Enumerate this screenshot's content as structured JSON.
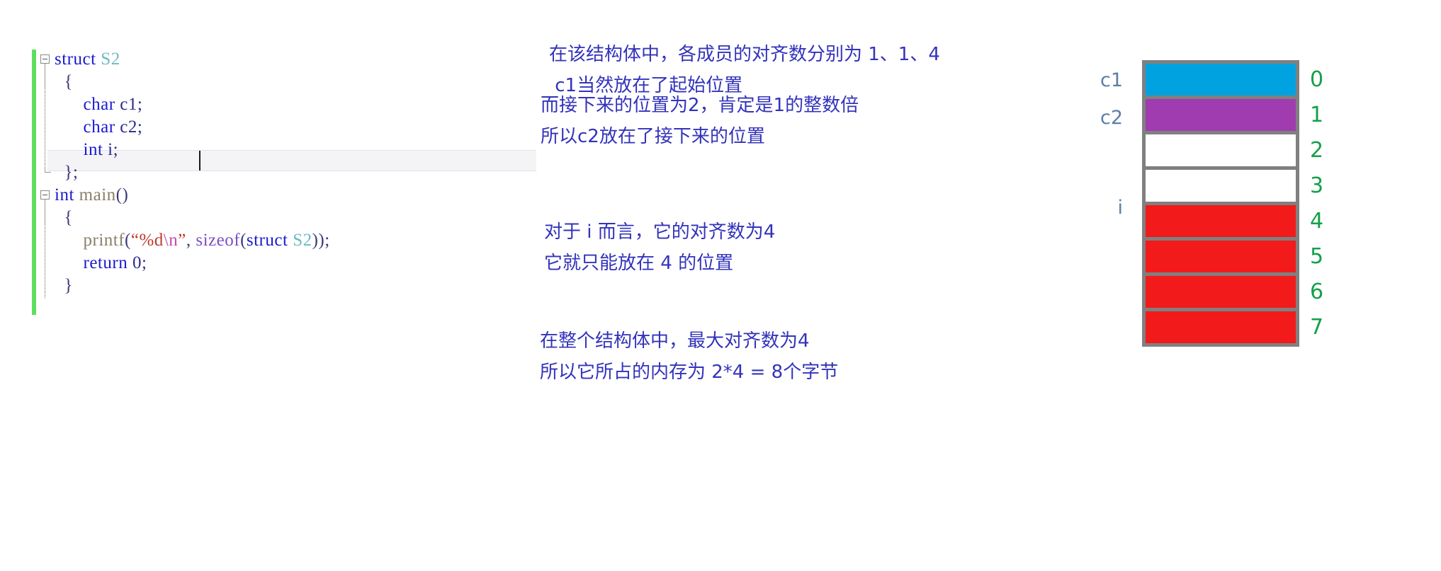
{
  "editor": {
    "language": "c",
    "change_bar_color": "#5fdf5f",
    "current_line_index": 3,
    "lines": [
      {
        "fold": "minus",
        "tokens": [
          {
            "t": "struct",
            "c": "kw"
          },
          {
            "t": " ",
            "c": "plain"
          },
          {
            "t": "S2",
            "c": "type"
          }
        ]
      },
      {
        "fold": "none",
        "tokens": [
          {
            "t": "  {",
            "c": "punc"
          }
        ]
      },
      {
        "fold": "none",
        "tokens": [
          {
            "t": "      ",
            "c": "plain"
          },
          {
            "t": "char",
            "c": "kw"
          },
          {
            "t": " c1;",
            "c": "plain"
          }
        ]
      },
      {
        "fold": "none",
        "tokens": [
          {
            "t": "      ",
            "c": "plain"
          },
          {
            "t": "char",
            "c": "kw"
          },
          {
            "t": " c2;",
            "c": "plain"
          }
        ]
      },
      {
        "fold": "none",
        "tokens": [
          {
            "t": "      ",
            "c": "plain"
          },
          {
            "t": "int",
            "c": "kw"
          },
          {
            "t": " i;",
            "c": "plain"
          }
        ]
      },
      {
        "fold": "none",
        "tokens": [
          {
            "t": "  };",
            "c": "punc"
          }
        ]
      },
      {
        "fold": "minus",
        "tokens": [
          {
            "t": "int",
            "c": "kw"
          },
          {
            "t": " ",
            "c": "plain"
          },
          {
            "t": "main",
            "c": "fn"
          },
          {
            "t": "()",
            "c": "punc"
          }
        ]
      },
      {
        "fold": "none",
        "tokens": [
          {
            "t": "  {",
            "c": "punc"
          }
        ]
      },
      {
        "fold": "none",
        "tokens": [
          {
            "t": "      ",
            "c": "plain"
          },
          {
            "t": "printf",
            "c": "fn"
          },
          {
            "t": "(",
            "c": "punc"
          },
          {
            "t": "“%d",
            "c": "str"
          },
          {
            "t": "\\n",
            "c": "esc"
          },
          {
            "t": "”",
            "c": "str"
          },
          {
            "t": ", ",
            "c": "punc"
          },
          {
            "t": "sizeof",
            "c": "szf"
          },
          {
            "t": "(",
            "c": "punc"
          },
          {
            "t": "struct",
            "c": "kw"
          },
          {
            "t": " ",
            "c": "plain"
          },
          {
            "t": "S2",
            "c": "type"
          },
          {
            "t": "));",
            "c": "punc"
          }
        ]
      },
      {
        "fold": "none",
        "tokens": [
          {
            "t": "      ",
            "c": "plain"
          },
          {
            "t": "return",
            "c": "kw"
          },
          {
            "t": " ",
            "c": "plain"
          },
          {
            "t": "0",
            "c": "num"
          },
          {
            "t": ";",
            "c": "punc"
          }
        ]
      },
      {
        "fold": "none",
        "tokens": [
          {
            "t": "  }",
            "c": "punc"
          }
        ]
      }
    ],
    "plain_text": "struct S2\n  {\n      char c1;\n      char c2;\n      int i;\n  };\nint main()\n  {\n      printf(“%d\\n”, sizeof(struct S2));\n      return 0;\n  }"
  },
  "annotations": {
    "text_color": "#3333bb",
    "blocks": [
      {
        "id": "note-1",
        "lines": [
          "在该结构体中，各成员的对齐数分别为 1、1、4",
          " c1当然放在了起始位置"
        ]
      },
      {
        "id": "note-2",
        "lines": [
          "而接下来的位置为2，肯定是1的整数倍",
          "所以c2放在了接下来的位置"
        ]
      },
      {
        "id": "note-3",
        "lines": [
          "对于 i 而言，它的对齐数为4",
          "它就只能放在 4 的位置"
        ]
      },
      {
        "id": "note-4",
        "lines": [
          "在整个结构体中，最大对齐数为4",
          "所以它所占的内存为 2*4 = 8个字节"
        ]
      }
    ]
  },
  "memory_diagram": {
    "border_color": "#808080",
    "index_color": "#15a04a",
    "var_label_color": "#5b7fa6",
    "cells": [
      {
        "index": "0",
        "fill": "blue",
        "color": "#00a3e0",
        "var": "c1"
      },
      {
        "index": "1",
        "fill": "purple",
        "color": "#a03bb0",
        "var": "c2"
      },
      {
        "index": "2",
        "fill": "white",
        "color": "#ffffff",
        "var": ""
      },
      {
        "index": "3",
        "fill": "white",
        "color": "#ffffff",
        "var": ""
      },
      {
        "index": "4",
        "fill": "red",
        "color": "#f21a1a",
        "var": "i"
      },
      {
        "index": "5",
        "fill": "red",
        "color": "#f21a1a",
        "var": ""
      },
      {
        "index": "6",
        "fill": "red",
        "color": "#f21a1a",
        "var": ""
      },
      {
        "index": "7",
        "fill": "red",
        "color": "#f21a1a",
        "var": ""
      }
    ],
    "var_labels": [
      {
        "name": "c1",
        "cell": 0
      },
      {
        "name": "c2",
        "cell": 1
      },
      {
        "name": "i",
        "cell": 4
      }
    ]
  }
}
